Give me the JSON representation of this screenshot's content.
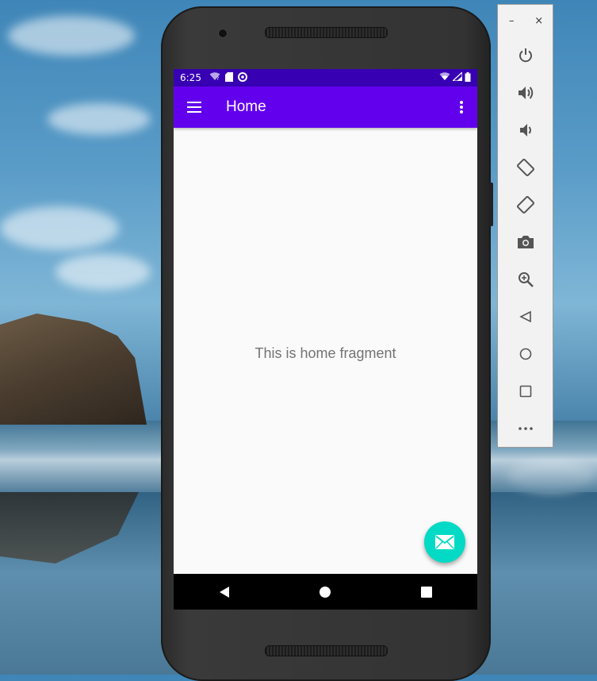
{
  "status_bar": {
    "time": "6:25",
    "left_icons": [
      "wifi-question-icon",
      "sd-card-icon",
      "sync-icon"
    ],
    "right_icons": [
      "wifi-icon",
      "signal-icon",
      "battery-icon"
    ]
  },
  "app_bar": {
    "title": "Home",
    "menu_icon": "hamburger-menu-icon",
    "overflow_icon": "more-vertical-icon"
  },
  "content": {
    "message": "This is home fragment"
  },
  "fab": {
    "icon": "email-icon"
  },
  "nav_bar": {
    "buttons": [
      "back-icon",
      "home-icon",
      "recents-icon"
    ]
  },
  "emulator_toolbar": {
    "window_controls": [
      "minimize",
      "close"
    ],
    "minimize_label": "–",
    "close_label": "×",
    "tools": [
      "power",
      "volume-up",
      "volume-down",
      "rotate-left",
      "rotate-right",
      "screenshot",
      "zoom",
      "back",
      "home",
      "overview",
      "more"
    ]
  },
  "colors": {
    "primary": "#6200ee",
    "primary_dark": "#3700b3",
    "secondary": "#03dac5",
    "content_text": "#737373"
  }
}
